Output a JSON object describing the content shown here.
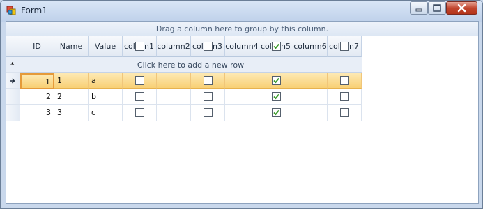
{
  "window": {
    "title": "Form1"
  },
  "group_panel": {
    "text": "Drag a column here to group by this column."
  },
  "columns": [
    {
      "label": "ID",
      "kind": "text"
    },
    {
      "label": "Name",
      "kind": "text"
    },
    {
      "label": "Value",
      "kind": "text"
    },
    {
      "prefix": "col",
      "suffix": "n1",
      "kind": "check"
    },
    {
      "label": "column2",
      "kind": "text"
    },
    {
      "prefix": "col",
      "suffix": "n3",
      "kind": "check"
    },
    {
      "label": "column4",
      "kind": "text"
    },
    {
      "prefix": "col",
      "suffix": "n5",
      "kind": "check",
      "header_checked": true
    },
    {
      "label": "column6",
      "kind": "text"
    },
    {
      "prefix": "col",
      "suffix": "n7",
      "kind": "check"
    }
  ],
  "new_row": {
    "marker": "*",
    "label": "Click here to add a new row"
  },
  "rows": [
    {
      "id": "1",
      "name": "1",
      "value": "a",
      "checks": [
        false,
        false,
        true,
        false
      ],
      "selected": true
    },
    {
      "id": "2",
      "name": "2",
      "value": "b",
      "checks": [
        false,
        false,
        true,
        false
      ],
      "selected": false
    },
    {
      "id": "3",
      "name": "3",
      "value": "c",
      "checks": [
        false,
        false,
        true,
        false
      ],
      "selected": false
    }
  ],
  "colors": {
    "selection": "#f8cf73",
    "check": "#3a9a2a",
    "close_button": "#c2462f"
  },
  "icons": {
    "app": "form-app-icon",
    "minimize": "minimize-icon",
    "maximize": "maximize-icon",
    "close": "close-icon",
    "current_row": "current-row-arrow-icon"
  }
}
